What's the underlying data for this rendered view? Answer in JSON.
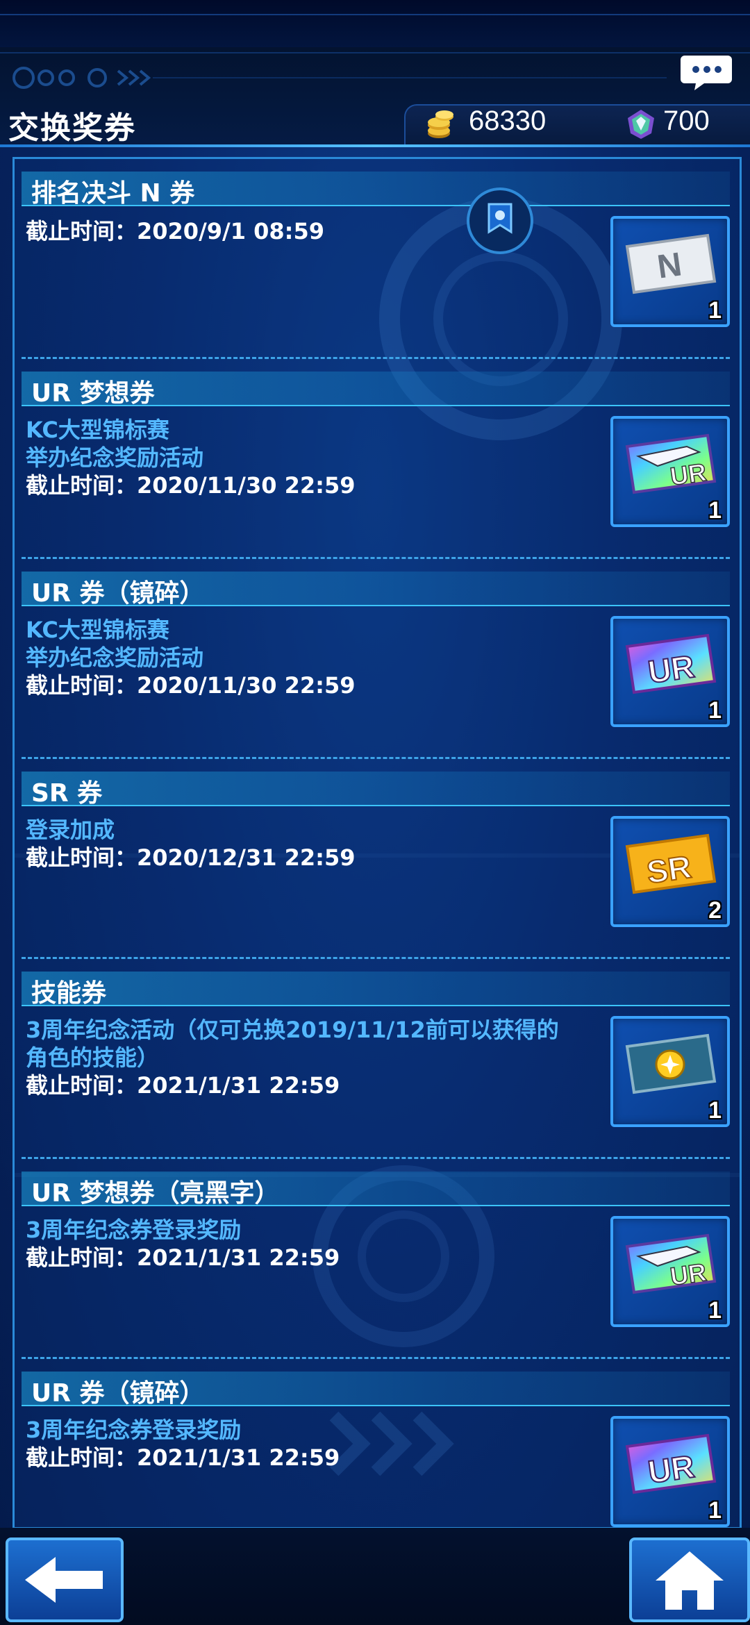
{
  "header": {
    "title": "交换奖券",
    "coins": "68330",
    "gems": "700",
    "coin_icon": "gold-coins-icon",
    "gem_icon": "gem-icon",
    "chat_icon": "chat-bubble-icon"
  },
  "tickets": [
    {
      "title": "排名决斗 N 券",
      "event": "",
      "deadline": "截止时间：2020/9/1 08:59",
      "count": "1",
      "icon": "n-ticket-icon"
    },
    {
      "title": "UR 梦想券",
      "event": "KC大型锦标赛\n举办纪念奖励活动",
      "deadline": "截止时间：2020/11/30 22:59",
      "count": "1",
      "icon": "ur-dream-ticket-icon"
    },
    {
      "title": "UR 券（镜碎）",
      "event": "KC大型锦标赛\n举办纪念奖励活动",
      "deadline": "截止时间：2020/11/30 22:59",
      "count": "1",
      "icon": "ur-shine-ticket-icon"
    },
    {
      "title": "SR 券",
      "event": "登录加成",
      "deadline": "截止时间：2020/12/31 22:59",
      "count": "2",
      "icon": "sr-ticket-icon"
    },
    {
      "title": "技能券",
      "event": "3周年纪念活动（仅可兑换2019/11/12前可以获得的\n角色的技能）",
      "deadline": "截止时间：2021/1/31 22:59",
      "count": "1",
      "icon": "skill-ticket-icon"
    },
    {
      "title": "UR 梦想券（亮黑字）",
      "event": "3周年纪念券登录奖励",
      "deadline": "截止时间：2021/1/31 22:59",
      "count": "1",
      "icon": "ur-dream-ticket-icon"
    },
    {
      "title": "UR 券（镜碎）",
      "event": "3周年纪念券登录奖励",
      "deadline": "截止时间：2021/1/31 22:59",
      "count": "1",
      "icon": "ur-shine-ticket-icon"
    }
  ],
  "footer": {
    "back_icon": "back-arrow-icon",
    "home_icon": "home-icon"
  },
  "colors": {
    "accent": "#3aa2ff",
    "event_text": "#54b8ff",
    "background": "#08286a"
  }
}
